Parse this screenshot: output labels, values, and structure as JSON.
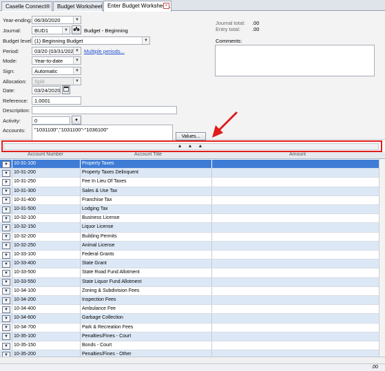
{
  "tabs": [
    {
      "label": "Caselle Connect®"
    },
    {
      "label": "Budget Worksheet"
    },
    {
      "label": "Enter Budget Worksheet..."
    }
  ],
  "form": {
    "year_ending": {
      "label": "Year-ending:",
      "value": "06/30/2020"
    },
    "journal": {
      "label": "Journal:",
      "value": "BUD1",
      "desc": "Budget - Beginning"
    },
    "budget_level": {
      "label": "Budget level:",
      "value": "(1) Beginning Budget"
    },
    "period": {
      "label": "Period:",
      "value": "03/20 (03/31/2020)",
      "link": "Multiple periods..."
    },
    "mode": {
      "label": "Mode:",
      "value": "Year-to-date"
    },
    "sign": {
      "label": "Sign:",
      "value": "Automatic"
    },
    "allocation": {
      "label": "Allocation:",
      "value": "Split"
    },
    "date": {
      "label": "Date:",
      "value": "03/24/2020"
    },
    "reference": {
      "label": "Reference:",
      "value": "1.0001"
    },
    "description": {
      "label": "Description:",
      "value": ""
    },
    "activity": {
      "label": "Activity:",
      "value": "0"
    },
    "accounts": {
      "label": "Accounts:",
      "value": "\"1031100\",\"1031100\"-\"1036100\"",
      "button": "Values..."
    },
    "journal_total": {
      "label": "Journal total:",
      "value": ".00"
    },
    "entry_total": {
      "label": "Entry total:",
      "value": ".00"
    },
    "comments": {
      "label": "Comments:",
      "value": ""
    }
  },
  "splitter": {
    "label": "▲ ▲ ▲"
  },
  "grid": {
    "columns": [
      "Account Number",
      "Account Title",
      "Amount"
    ],
    "rows": [
      {
        "acct": "10-31-100",
        "title": "Property Taxes"
      },
      {
        "acct": "10-31-200",
        "title": "Property Taxes Delinquent"
      },
      {
        "acct": "10-31-250",
        "title": "Fee In Lieu Of Taxes"
      },
      {
        "acct": "10-31-300",
        "title": "Sales & Use Tax"
      },
      {
        "acct": "10-31-400",
        "title": "Franchise Tax"
      },
      {
        "acct": "10-31-500",
        "title": "Lodging Tax"
      },
      {
        "acct": "10-32-100",
        "title": "Business License"
      },
      {
        "acct": "10-32-150",
        "title": "Liquor License"
      },
      {
        "acct": "10-32-200",
        "title": "Building Permits"
      },
      {
        "acct": "10-32-250",
        "title": "Animal License"
      },
      {
        "acct": "10-33-100",
        "title": "Federal Grants"
      },
      {
        "acct": "10-33-400",
        "title": "State Grant"
      },
      {
        "acct": "10-33-500",
        "title": "State Road Fund Allotment"
      },
      {
        "acct": "10-33-550",
        "title": "State Liquor Fund Allotment"
      },
      {
        "acct": "10-34-100",
        "title": "Zoning & Subdivision Fees"
      },
      {
        "acct": "10-34-200",
        "title": "Inspection Fees"
      },
      {
        "acct": "10-34-400",
        "title": "Ambulance Fee"
      },
      {
        "acct": "10-34-600",
        "title": "Garbage Collection"
      },
      {
        "acct": "10-34-700",
        "title": "Park & Recreation Fees"
      },
      {
        "acct": "10-35-100",
        "title": "Penalties/Fines - Court"
      },
      {
        "acct": "10-35-150",
        "title": "Bonds - Court"
      },
      {
        "acct": "10-35-200",
        "title": "Penalties/Fines - Other"
      }
    ]
  },
  "status": {
    "total": ".00"
  },
  "colors": {
    "accent": "#3f7cd6",
    "annotation": "#e01b1b",
    "row_alt": "#dde8f6"
  }
}
